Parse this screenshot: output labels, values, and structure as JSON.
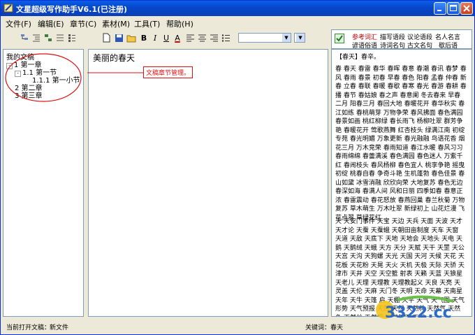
{
  "window": {
    "title": "文星超级写作助手V6.1(已注册)"
  },
  "menu": [
    "文件(F)",
    "编辑(E)",
    "章节(C)",
    "素材(M)",
    "工具(T)",
    "帮助(H)"
  ],
  "tree": {
    "root": "我的文稿",
    "nodes": [
      "1 第一章",
      "1.1 第一节",
      "1.1.1 第一小节",
      "2 第二章",
      "3 第三章"
    ]
  },
  "annotation": {
    "text": "文稿章节管理。"
  },
  "editor": {
    "title": "美丽的春天"
  },
  "toolbar_text": {
    "bold": "B",
    "italic": "I",
    "underline": "U",
    "color": "A"
  },
  "right_tabs": {
    "row1": [
      "参考词汇",
      "描写语段",
      "议论语段",
      "名人名言"
    ],
    "row2": [
      "谚语俗语",
      "诗词名句",
      "古文名句",
      "歇后语"
    ]
  },
  "right_panel": {
    "heading": "【春天】春辛。",
    "block1": "春 春天 春雷 春华 春晖 春意 春潮 春讯 春梦 春风 春雨 春景 初春 早春 春色 阳春 孟春 仲春 新春 立春 春联 春暖 春歇 春寒 春光 春游 春耕 春播 春节 春姑娘 春之声 春意阑 冬去春来 早春二月 阳春三月 春回大地 春暖花开 春华秋实 春江如练 春桃萌芽 万物争荣 春风拂面 春色满园 春景如画 桃红柳绿 春长雨飞 杨柳吐翠 群芳争艳 春暖花开 莺歌燕舞 红杏枝头 绿满江南 初绽专苑 春光明媚 万象更新 春光融融 鸟语花香 烟花三月 万木竞荣 春雨知道 春江水暖 春风习习 春雨绵绵 春蕾满溪 春色满园 春色迷人 万紫千红 春闹枝头 春风杨柳 春色宜人 桃李争艳 摇曳初绽 桃春自春 争奇斗艳 生机蓬勃 春色佳景 春山如黛 冰雪消融 欣欣向荣 大地复苏 春色无边 春深如海 春满人间 风和日丽 四季如春 春意正浓 春雷震动 春花怒放 春燕回巢 春兰秋菊 万物复苏 草木萌生 万木吐翠 新绿初上 山花烂漫 飞花点翠 草绿花红",
    "block2": "天 天安门事件 天宝 天边 天兵 天面 天波 天才 天才论 天蚕 天蚕蛾 天朝田亩制度 天车 天窗 天道 天敌 天底下 天地 天地会 天地头 天电 天鹅 天鹅绒 天蛾 天方 天分 天赋 天干 天罡 天公 天宫 天沟 天狗螺 天光 天国 天河 天候 天花 天花板 天花粉 天晃 天火 天机 天极 天际 天骄 天津市 天井 天空 天空籃 射表 天籁 天蓝 天狼星 天老儿 天理 天理教 天理教起义 天良 天亮 天灵盖 天伦 天麻 天门冬 天明 天命 天幕 天南星 天年 天牛 天篷 启 天棚 天平 天气 天气图 天气形势 天气预报 天然 天然 天然林 天然气 天然色 天然丝 天然堤 天然气田 天然"
  },
  "status": {
    "open_doc_label": "当前打开文稿：",
    "open_doc": "新文件",
    "keyword_label": "关键词：",
    "keyword": "春天"
  },
  "watermark": "3322.cc"
}
